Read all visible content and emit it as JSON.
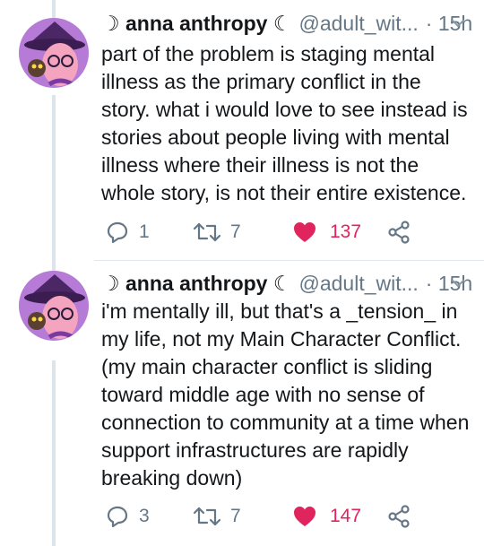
{
  "tweets": [
    {
      "author_name": "☽ anna anthropy ☾",
      "handle": "@adult_wit...",
      "time": "· 15h",
      "text": "part of the problem is staging mental illness as the primary conflict in the story. what i would love to see instead is stories about people living with mental illness where their illness is not the whole story, is not their entire existence.",
      "replies": "1",
      "retweets": "7",
      "likes": "137"
    },
    {
      "author_name": "☽ anna anthropy ☾",
      "handle": "@adult_wit...",
      "time": "· 15h",
      "text": "i'm mentally ill, but that's a _tension_ in my life, not my Main Character Conflict. (my main character conflict is sliding toward middle age with no sense of connection to community at a time when support infrastructures are rapidly breaking down)",
      "replies": "3",
      "retweets": "7",
      "likes": "147"
    }
  ],
  "colors": {
    "text": "#14171a",
    "secondary": "#657786",
    "like": "#e0245e",
    "thread_line": "#dde5ec",
    "avatar_bg": "#b57bd6"
  },
  "icons": [
    "reply-icon",
    "retweet-icon",
    "heart-icon",
    "share-icon",
    "chevron-down-icon"
  ]
}
